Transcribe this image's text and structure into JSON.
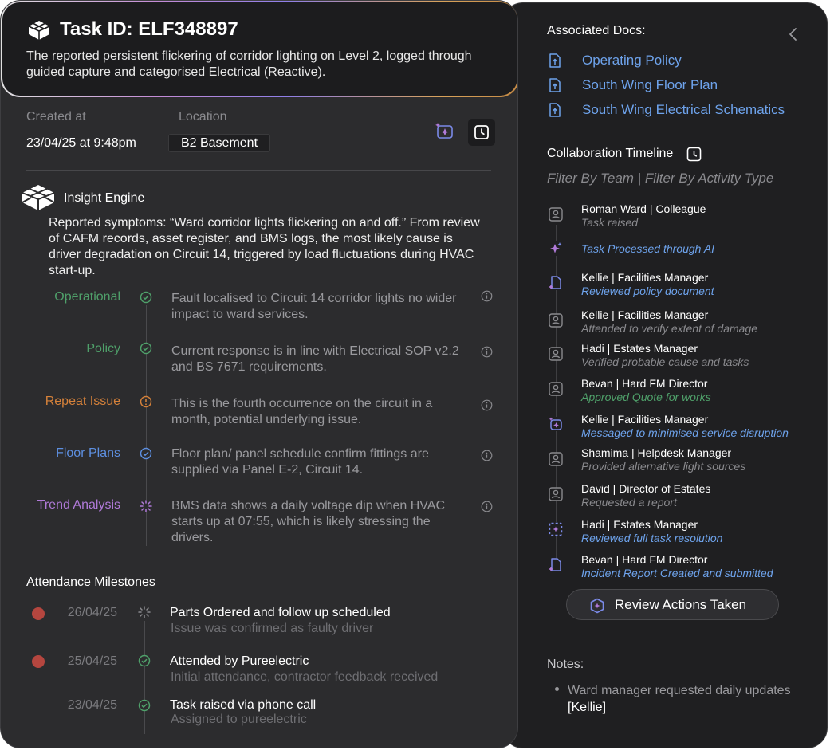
{
  "task": {
    "title": "Task ID: ELF348897",
    "description": "The reported persistent flickering of corridor lighting on Level 2, logged through guided capture and categorised Electrical (Reactive)."
  },
  "meta": {
    "created_label": "Created at",
    "created_value": "23/04/25 at 9:48pm",
    "location_label": "Location",
    "location_value": "B2 Basement"
  },
  "insight": {
    "title": "Insight Engine",
    "summary": "Reported symptoms: “Ward corridor lights flickering on and off.” From review of CAFM records, asset register, and BMS logs, the most likely cause is driver degradation on Circuit 14, triggered by load fluctuations during HVAC start-up.",
    "items": [
      {
        "label": "Operational",
        "text": "Fault localised to Circuit 14 corridor lights no wider impact to ward services.",
        "color": "#4fa06a",
        "icon": "check-circle-icon"
      },
      {
        "label": "Policy",
        "text": "Current response is in line with Electrical SOP v2.2 and BS 7671 requirements.",
        "color": "#4fa06a",
        "icon": "check-circle-icon"
      },
      {
        "label": "Repeat Issue",
        "text": "This is the fourth occurrence on the circuit in a month, potential underlying issue.",
        "color": "#d5813a",
        "icon": "alert-circle-icon"
      },
      {
        "label": "Floor Plans",
        "text": "Floor plan/ panel schedule confirm fittings are supplied via Panel E-2, Circuit 14.",
        "color": "#5d8fe0",
        "icon": "check-circle-icon"
      },
      {
        "label": "Trend Analysis",
        "text": "BMS data shows a daily voltage dip when HVAC starts up at 07:55, which is likely stressing the drivers.",
        "color": "#b07ad8",
        "icon": "loading-spinner-icon"
      }
    ]
  },
  "milestones": {
    "title": "Attendance Milestones",
    "items": [
      {
        "date": "26/04/25",
        "title": "Parts Ordered and follow up scheduled",
        "sub": "Issue was confirmed as faulty driver",
        "icon": "loading-spinner-icon",
        "flag": true
      },
      {
        "date": "25/04/25",
        "title": "Attended by Pureelectric",
        "sub": "Initial attendance, contractor feedback received",
        "icon": "check-circle-icon",
        "flag": true
      },
      {
        "date": "23/04/25",
        "title": "Task raised via phone call",
        "sub": "Assigned to pureelectric",
        "icon": "check-circle-icon",
        "flag": false
      }
    ]
  },
  "docs": {
    "title": "Associated Docs:",
    "items": [
      "Operating Policy",
      "South Wing Floor Plan",
      "South Wing Electrical Schematics"
    ]
  },
  "timeline": {
    "title": "Collaboration Timeline",
    "filter": "Filter By Team | Filter By Activity Type",
    "items": [
      {
        "name": "Roman Ward | Colleague",
        "activity": "Task raised",
        "icon": "user-icon",
        "color": "#8a8a8e"
      },
      {
        "name": "",
        "activity": "Task Processed through AI",
        "icon": "sparkle-icon",
        "color": "#6ea3ec"
      },
      {
        "name": "Kellie | Facilities Manager",
        "activity": "Reviewed policy document",
        "icon": "document-icon",
        "color": "#6ea3ec"
      },
      {
        "name": "Kellie | Facilities Manager",
        "activity": "Attended to verify extent of damage",
        "icon": "user-icon",
        "color": "#8a8a8e"
      },
      {
        "name": "Hadi | Estates Manager",
        "activity": "Verified probable cause and tasks",
        "icon": "user-icon",
        "color": "#8a8a8e"
      },
      {
        "name": "Bevan | Hard FM Director",
        "activity": "Approved Quote for works",
        "icon": "user-icon",
        "color": "#4fa06a"
      },
      {
        "name": "Kellie | Facilities Manager",
        "activity": "Messaged to minimised service disruption",
        "icon": "ai-message-icon",
        "color": "#6ea3ec"
      },
      {
        "name": "Shamima | Helpdesk Manager",
        "activity": "Provided alternative light sources",
        "icon": "user-icon",
        "color": "#8a8a8e"
      },
      {
        "name": "David | Director of Estates",
        "activity": "Requested a report",
        "icon": "user-icon",
        "color": "#8a8a8e"
      },
      {
        "name": "Hadi | Estates Manager",
        "activity": "Reviewed full task resolution",
        "icon": "scan-icon",
        "color": "#6ea3ec"
      },
      {
        "name": "Bevan | Hard FM Director",
        "activity": "Incident Report Created and submitted",
        "icon": "document-icon",
        "color": "#6ea3ec"
      }
    ]
  },
  "review_button": "Review Actions Taken",
  "notes": {
    "title": "Notes:",
    "text": "Ward manager requested daily updates",
    "tag": "[Kellie]"
  }
}
